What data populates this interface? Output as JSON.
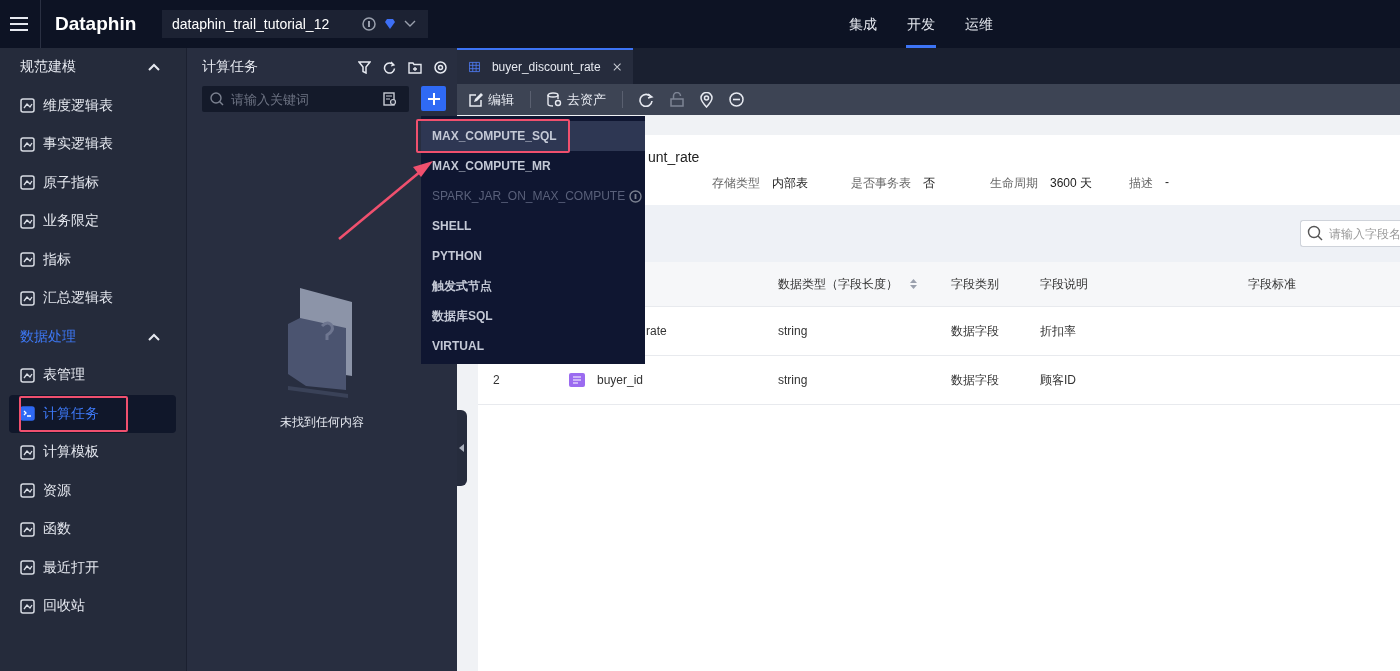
{
  "topbar": {
    "logo": "Dataphin",
    "project": "dataphin_trail_tutorial_12",
    "nav": [
      {
        "label": "集成",
        "selected": false
      },
      {
        "label": "开发",
        "selected": true
      },
      {
        "label": "运维",
        "selected": false
      }
    ]
  },
  "sidebar": {
    "groups": [
      {
        "title": "规范建模",
        "expanded": true,
        "active": false,
        "items": [
          {
            "label": "维度逻辑表",
            "selected": false,
            "annotated": false
          },
          {
            "label": "事实逻辑表",
            "selected": false,
            "annotated": false
          },
          {
            "label": "原子指标",
            "selected": false,
            "annotated": false
          },
          {
            "label": "业务限定",
            "selected": false,
            "annotated": false
          },
          {
            "label": "指标",
            "selected": false,
            "annotated": false
          },
          {
            "label": "汇总逻辑表",
            "selected": false,
            "annotated": false
          }
        ]
      },
      {
        "title": "数据处理",
        "expanded": true,
        "active": true,
        "items": [
          {
            "label": "表管理",
            "selected": false,
            "annotated": false
          },
          {
            "label": "计算任务",
            "selected": true,
            "annotated": true
          },
          {
            "label": "计算模板",
            "selected": false,
            "annotated": false
          },
          {
            "label": "资源",
            "selected": false,
            "annotated": false
          },
          {
            "label": "函数",
            "selected": false,
            "annotated": false
          },
          {
            "label": "最近打开",
            "selected": false,
            "annotated": false
          },
          {
            "label": "回收站",
            "selected": false,
            "annotated": false
          }
        ]
      }
    ]
  },
  "task_panel": {
    "title": "计算任务",
    "search": {
      "placeholder": "请输入关键词"
    },
    "empty_text": "未找到任何内容"
  },
  "new_menu": {
    "items": [
      {
        "label": "MAX_COMPUTE_SQL",
        "selected": true,
        "disabled": false,
        "info": false,
        "annotated": true
      },
      {
        "label": "MAX_COMPUTE_MR",
        "selected": false,
        "disabled": false,
        "info": false,
        "annotated": false
      },
      {
        "label": "SPARK_JAR_ON_MAX_COMPUTE",
        "selected": false,
        "disabled": true,
        "info": true,
        "annotated": false
      },
      {
        "label": "SHELL",
        "selected": false,
        "disabled": false,
        "info": false,
        "annotated": false
      },
      {
        "label": "PYTHON",
        "selected": false,
        "disabled": false,
        "info": false,
        "annotated": false
      },
      {
        "label": "触发式节点",
        "selected": false,
        "disabled": false,
        "info": false,
        "annotated": false
      },
      {
        "label": "数据库SQL",
        "selected": false,
        "disabled": false,
        "info": false,
        "annotated": false
      },
      {
        "label": "VIRTUAL",
        "selected": false,
        "disabled": false,
        "info": false,
        "annotated": false
      }
    ]
  },
  "tabs": [
    {
      "label": "buyer_discount_rate",
      "selected": true
    }
  ],
  "toolbar": {
    "buttons": [
      {
        "label": "编辑"
      },
      {
        "label": "去资产"
      }
    ]
  },
  "table_info": {
    "title": "unt_rate",
    "meta": [
      {
        "label": "存储类型",
        "value": "内部表"
      },
      {
        "label": "是否事务表",
        "value": "否"
      },
      {
        "label": "生命周期",
        "value": "3600 天"
      },
      {
        "label": "描述",
        "value": "-"
      }
    ]
  },
  "field_search": {
    "placeholder": "请输入字段名"
  },
  "table": {
    "columns": [
      "数据类型（字段长度）",
      "字段类别",
      "字段说明",
      "字段标准"
    ],
    "rows": [
      {
        "name": "rate",
        "type": "string",
        "category": "数据字段",
        "description": "折扣率"
      },
      {
        "number": "2",
        "name": "buyer_id",
        "type": "string",
        "category": "数据字段",
        "description": "顾客ID"
      }
    ]
  }
}
